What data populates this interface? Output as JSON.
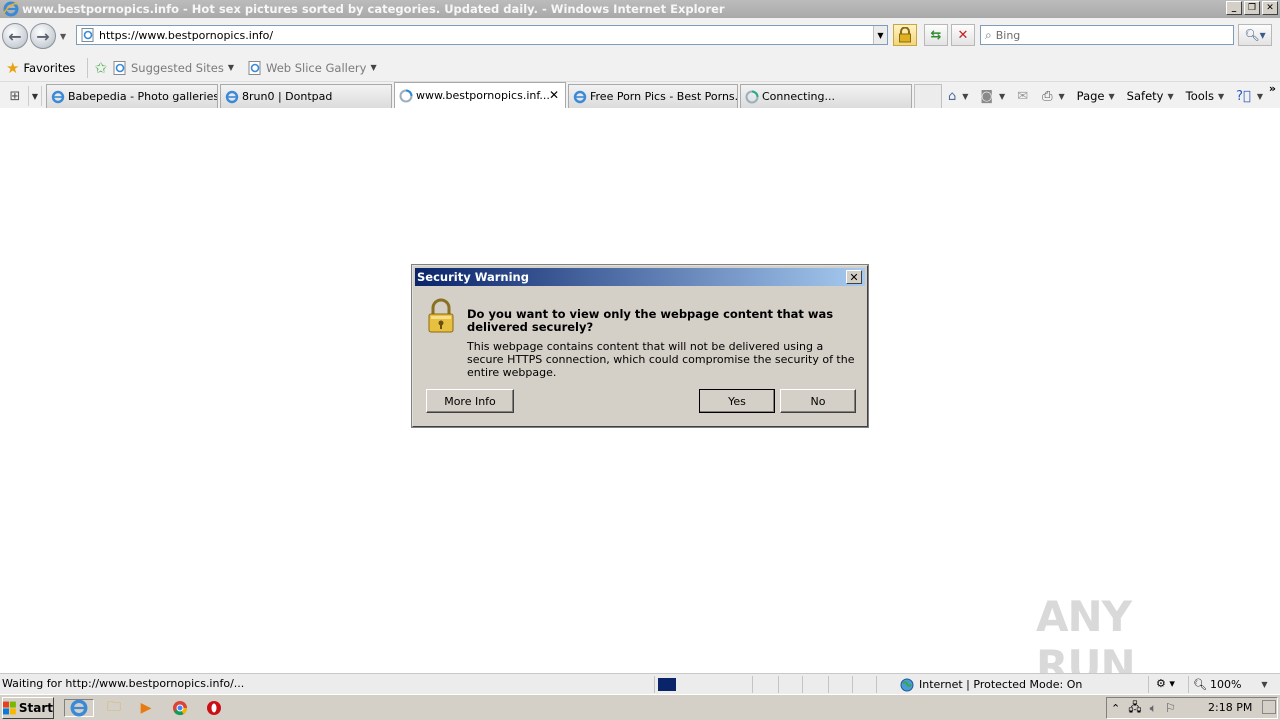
{
  "window": {
    "title": "www.bestpornopics.info - Hot sex pictures sorted by categories. Updated daily. - Windows Internet Explorer",
    "min_label": "_",
    "max_label": "❐",
    "close_label": "✕"
  },
  "address": {
    "url": "https://www.bestpornopics.info/",
    "search_placeholder": "Bing"
  },
  "favorites": {
    "favorites_label": "Favorites",
    "suggested_sites": "Suggested Sites",
    "web_slice_gallery": "Web Slice Gallery"
  },
  "tabs": [
    {
      "label": "Babepedia - Photo galleries ...",
      "active": false
    },
    {
      "label": "8run0 | Dontpad",
      "active": false
    },
    {
      "label": "www.bestpornopics.inf...",
      "active": true
    },
    {
      "label": "Free Porn Pics - Best Porns...",
      "active": false
    },
    {
      "label": "Connecting...",
      "active": false
    }
  ],
  "commandbar": {
    "page": "Page",
    "safety": "Safety",
    "tools": "Tools"
  },
  "dialog": {
    "title": "Security Warning",
    "question": "Do you want to view only the webpage content that was delivered securely?",
    "body": "This webpage contains content that will not be delivered using a secure HTTPS connection, which could compromise the security of the entire webpage.",
    "more_info": "More Info",
    "yes": "Yes",
    "no": "No"
  },
  "statusbar": {
    "text": "Waiting for http://www.bestpornopics.info/...",
    "zone": "Internet | Protected Mode: On",
    "zoom": "100%"
  },
  "taskbar": {
    "start": "Start",
    "clock": "2:18 PM"
  },
  "watermark": "ANY RUN"
}
